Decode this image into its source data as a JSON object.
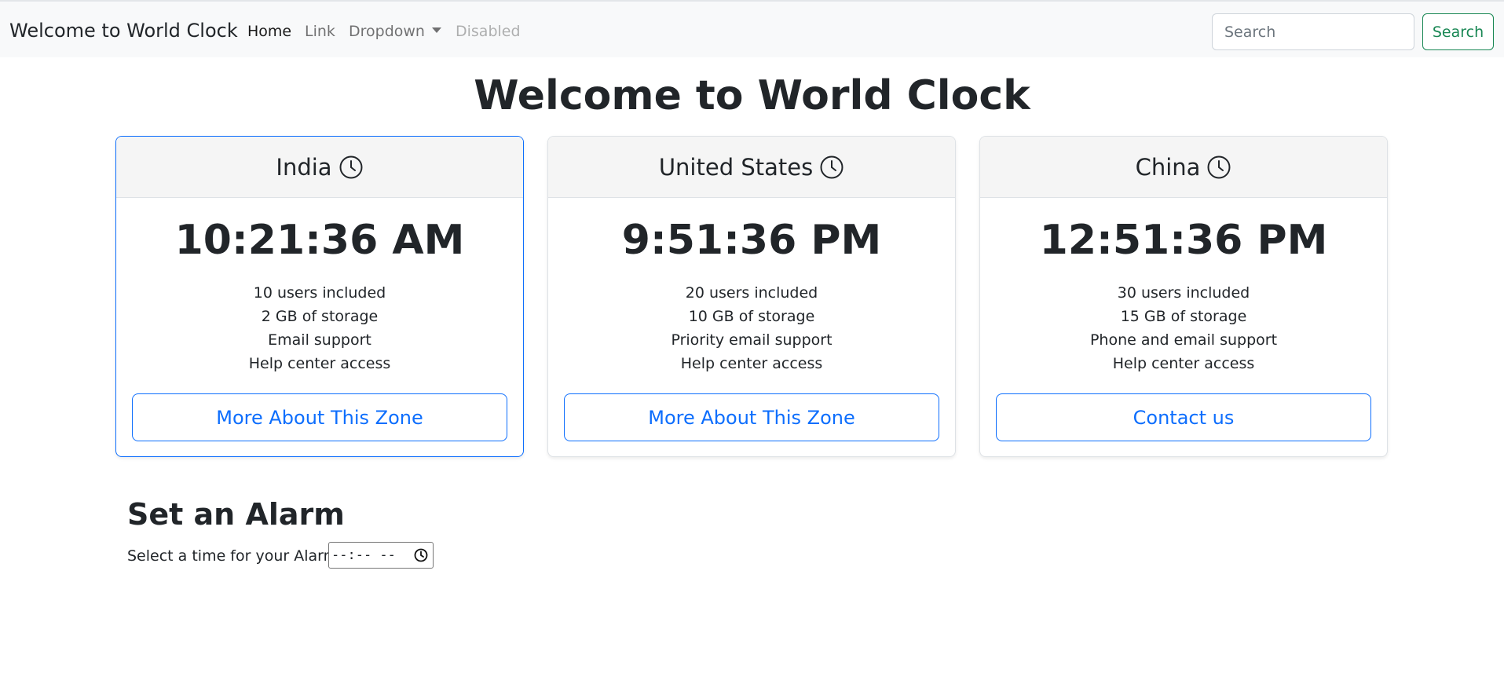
{
  "navbar": {
    "brand": "Welcome to World Clock",
    "links": [
      "Home",
      "Link",
      "Dropdown",
      "Disabled"
    ],
    "search_placeholder": "Search",
    "search_button": "Search"
  },
  "page_title": "Welcome to World Clock",
  "cards": [
    {
      "country": "India",
      "time": "10:21:36 AM",
      "features": [
        "10 users included",
        "2 GB of storage",
        "Email support",
        "Help center access"
      ],
      "button": "More About This Zone"
    },
    {
      "country": "United States",
      "time": "9:51:36 PM",
      "features": [
        "20 users included",
        "10 GB of storage",
        "Priority email support",
        "Help center access"
      ],
      "button": "More About This Zone"
    },
    {
      "country": "China",
      "time": "12:51:36 PM",
      "features": [
        "30 users included",
        "15 GB of storage",
        "Phone and email support",
        "Help center access"
      ],
      "button": "Contact us"
    }
  ],
  "alarm": {
    "title": "Set an Alarm",
    "label": "Select a time for your Alarm:",
    "time_value": "--:-- --"
  },
  "colors": {
    "primary": "#0d6efd",
    "success": "#198754",
    "navbar_bg": "#f8f9fa"
  },
  "icons": {
    "card_header": "clock-icon",
    "time_input": "clock-icon"
  }
}
